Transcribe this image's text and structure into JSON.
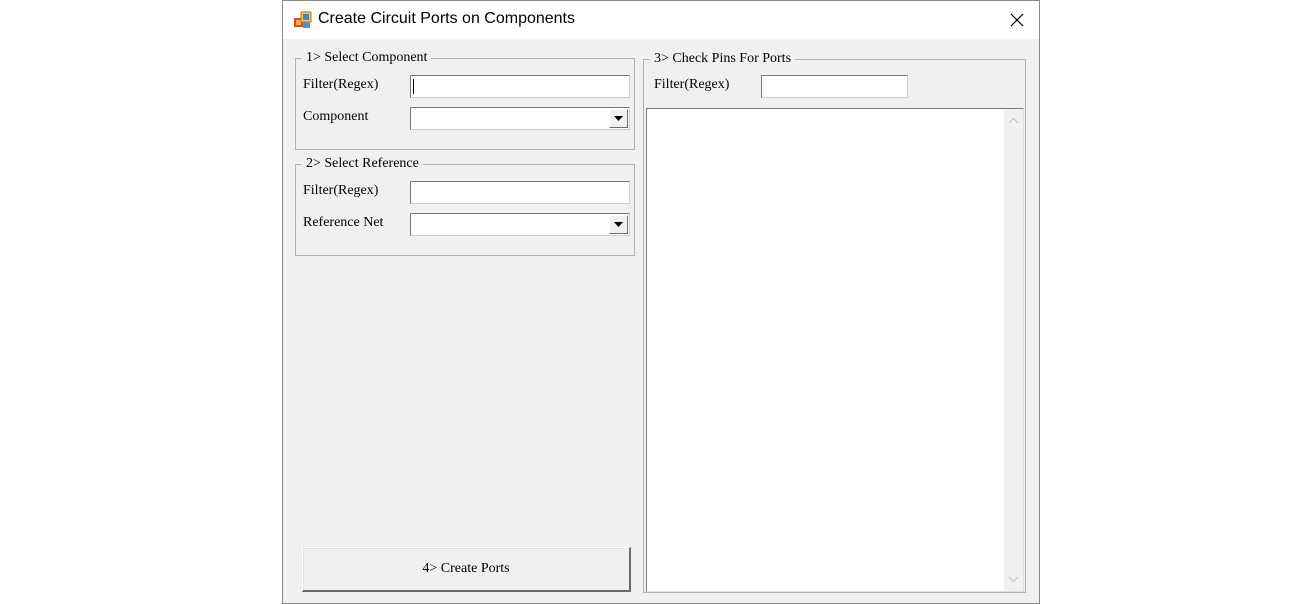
{
  "window": {
    "title": "Create Circuit Ports on Components"
  },
  "icons": {
    "app": "app-icon",
    "close": "close-icon",
    "dropdown": "chevron-down-icon",
    "scroll_up": "chevron-up-icon",
    "scroll_down": "chevron-down-icon"
  },
  "group1": {
    "legend": "1> Select Component",
    "filter_label": "Filter(Regex)",
    "filter_value": "",
    "component_label": "Component",
    "component_value": ""
  },
  "group2": {
    "legend": "2> Select Reference",
    "filter_label": "Filter(Regex)",
    "filter_value": "",
    "refnet_label": "Reference Net",
    "refnet_value": ""
  },
  "group3": {
    "legend": "3> Check Pins For Ports",
    "filter_label": "Filter(Regex)",
    "filter_value": "",
    "pins": []
  },
  "create_button": {
    "label": "4> Create Ports"
  }
}
